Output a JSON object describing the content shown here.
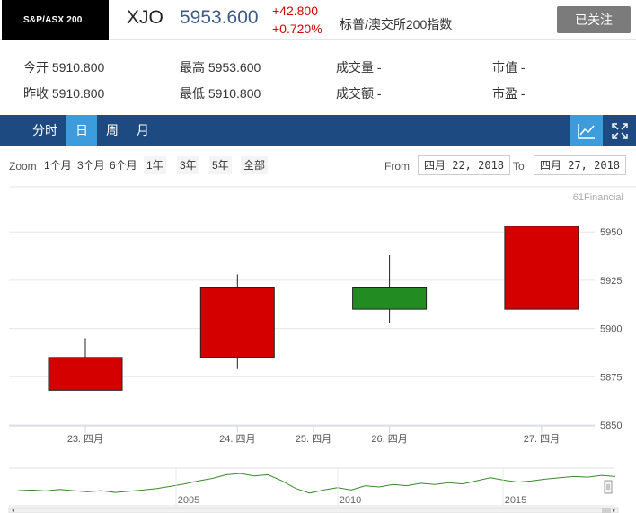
{
  "header": {
    "logo": "S&P/ASX 200",
    "ticker": "XJO",
    "price": "5953.600",
    "change": "+42.800",
    "change_pct": "+0.720%",
    "index_name": "标普/澳交所200指数",
    "follow_label": "已关注"
  },
  "stats": {
    "open": "今开 5910.800",
    "prev_close": "昨收 5910.800",
    "high": "最高 5953.600",
    "low": "最低 5910.800",
    "volume": "成交量 -",
    "turnover": "成交额 -",
    "market_cap": "市值 -",
    "pe": "市盈 -"
  },
  "tabs": [
    "分时",
    "日",
    "周",
    "月"
  ],
  "active_tab": "日",
  "icons": {
    "chart": "line-chart-icon",
    "fullscreen": "fullscreen-icon"
  },
  "zoom": {
    "label": "Zoom",
    "options": [
      "1个月",
      "3个月",
      "6个月",
      "1年",
      "3年",
      "5年",
      "全部"
    ],
    "from_label": "From",
    "from_value": "四月 22, 2018",
    "to_label": "To",
    "to_value": "四月 27, 2018"
  },
  "colors": {
    "up": "#d40000",
    "down": "#228b22",
    "navy": "#1d4a80",
    "accent": "#3d9ddc"
  },
  "chart_data": {
    "type": "candlestick",
    "credit": "61Financial",
    "y_ticks": [
      5850,
      5875,
      5900,
      5925,
      5950
    ],
    "ylim": [
      5850,
      5965
    ],
    "x_tick_labels": [
      {
        "label": "23. 四月",
        "idx": 0
      },
      {
        "label": "24. 四月",
        "idx": 1
      },
      {
        "label": "25. 四月",
        "idx": 1.5
      },
      {
        "label": "26. 四月",
        "idx": 2
      },
      {
        "label": "27. 四月",
        "idx": 3
      }
    ],
    "candles": [
      {
        "date": "23. 四月",
        "open": 5885,
        "close": 5868,
        "high": 5895,
        "low": 5868
      },
      {
        "date": "24. 四月",
        "open": 5921,
        "close": 5885,
        "high": 5928,
        "low": 5879
      },
      {
        "date": "26. 四月",
        "open": 5910,
        "close": 5921,
        "high": 5938,
        "low": 5903
      },
      {
        "date": "27. 四月",
        "open": 5953,
        "close": 5910,
        "high": 5953,
        "low": 5910
      }
    ],
    "navigator_labels": [
      "2005",
      "2010",
      "2015"
    ]
  }
}
